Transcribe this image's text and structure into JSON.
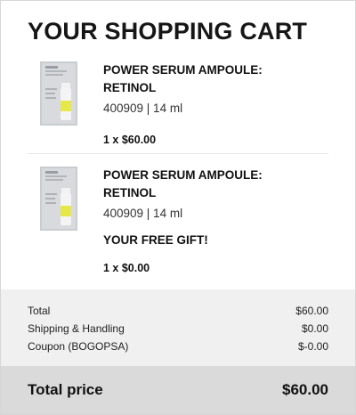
{
  "cart": {
    "title": "YOUR SHOPPING CART",
    "items": [
      {
        "name_line1": "POWER SERUM AMPOULE:",
        "name_line2": "RETINOL",
        "meta": "400909 | 14 ml",
        "gift_label": "",
        "qty_price": "1 x $60.00",
        "image_icon": "serum-ampoule-product-image"
      },
      {
        "name_line1": "POWER SERUM AMPOULE:",
        "name_line2": "RETINOL",
        "meta": "400909 | 14 ml",
        "gift_label": "YOUR FREE GIFT!",
        "qty_price": "1 x $0.00",
        "image_icon": "serum-ampoule-product-image"
      }
    ]
  },
  "totals": {
    "rows": [
      {
        "label": "Total",
        "value": "$60.00"
      },
      {
        "label": "Shipping & Handling",
        "value": "$0.00"
      },
      {
        "label": "Coupon (BOGOPSA)",
        "value": "$-0.00"
      }
    ],
    "grand_label": "Total price",
    "grand_value": "$60.00"
  },
  "colors": {
    "totals_bg": "#f0f0f0",
    "grand_bg": "#dadada",
    "product_accent": "#e6e84a"
  }
}
